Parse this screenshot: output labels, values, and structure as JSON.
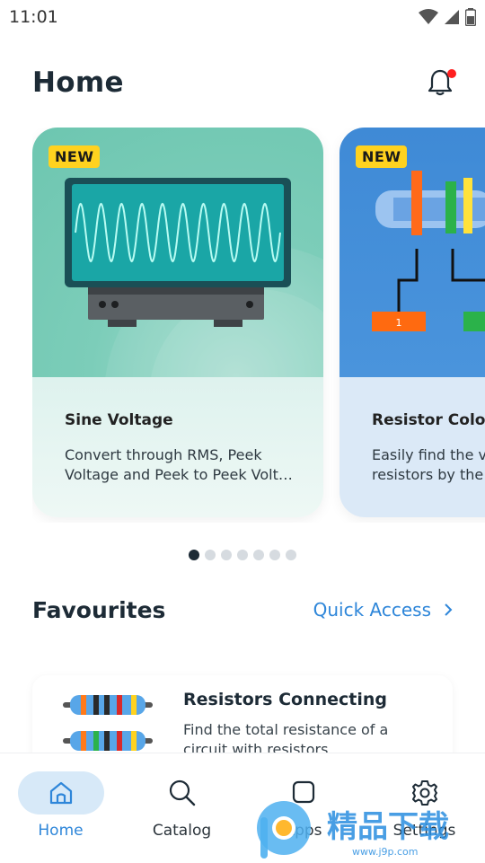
{
  "status_bar": {
    "time": "11:01"
  },
  "header": {
    "title": "Home"
  },
  "carousel": {
    "cards": [
      {
        "badge": "NEW",
        "title": "Sine Voltage",
        "description": "Convert through RMS, Peek Voltage and Peek to Peek Volt…"
      },
      {
        "badge": "NEW",
        "title": "Resistor Color",
        "description": "Easily find the v\nresistors by the",
        "pin_label": "1"
      }
    ],
    "dots_total": 7,
    "dots_active": 0
  },
  "favourites": {
    "title": "Favourites",
    "quick_access": "Quick Access",
    "items": [
      {
        "title": "Resistors Connecting",
        "description": "Find the total resistance of a circuit with resistors."
      }
    ]
  },
  "bottom_nav": {
    "items": [
      {
        "label": "Home",
        "icon": "home-icon"
      },
      {
        "label": "Catalog",
        "icon": "search-icon"
      },
      {
        "label": "Apps",
        "icon": "apps-icon"
      },
      {
        "label": "Settings",
        "icon": "gear-icon"
      }
    ],
    "active": 0
  },
  "watermark": {
    "text": "精品下载",
    "url_text": "www.j9p.com"
  },
  "colors": {
    "accent": "#2e86d9",
    "badge": "#ffd21f",
    "notification": "#ff1f1f",
    "card1": "#6dc6b0",
    "card2": "#4a94dc"
  }
}
